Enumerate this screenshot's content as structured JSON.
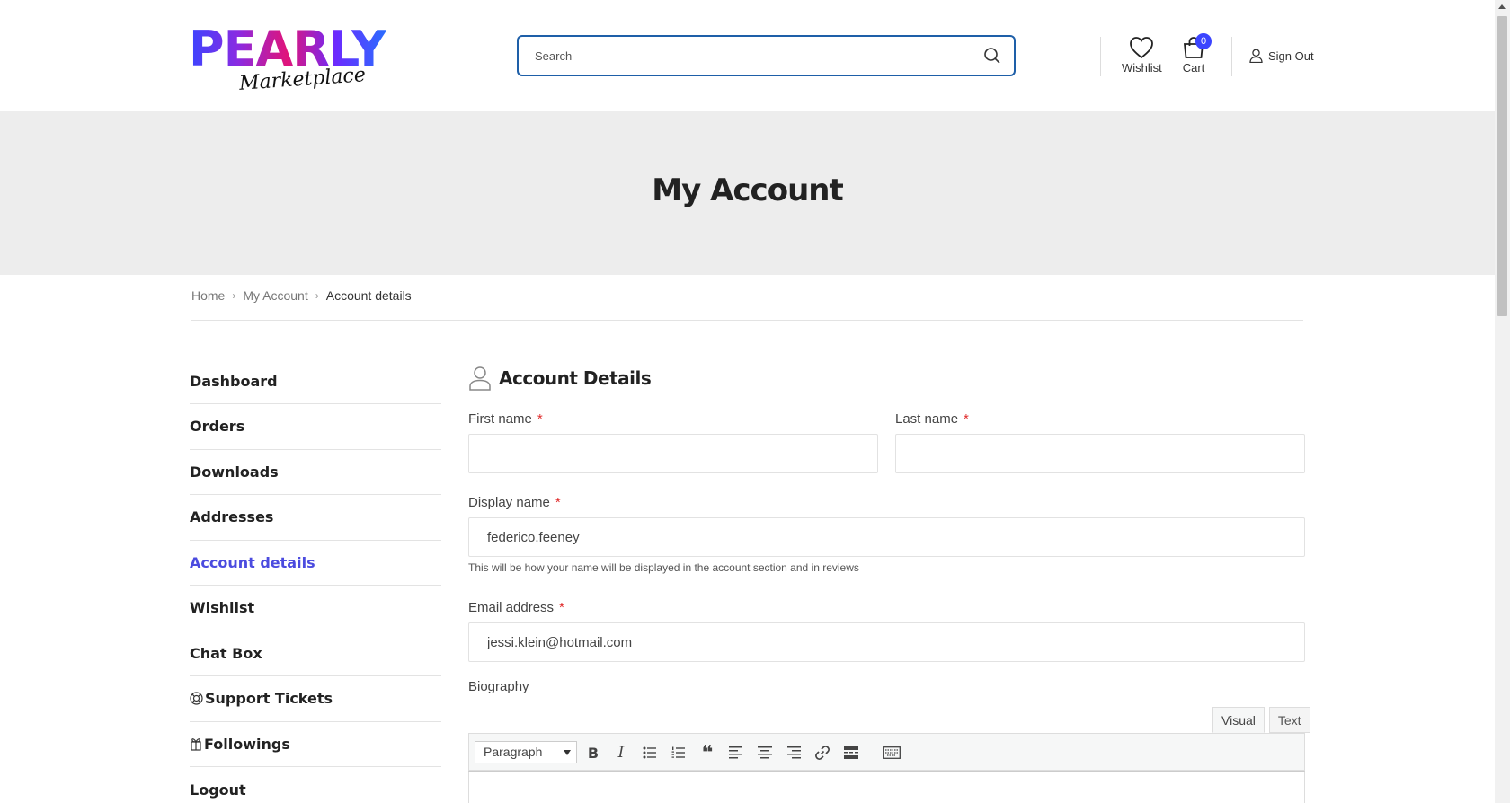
{
  "brand": {
    "name": "PEARLY",
    "tagline": "Marketplace"
  },
  "search": {
    "placeholder": "Search"
  },
  "header": {
    "wishlist_label": "Wishlist",
    "cart_label": "Cart",
    "cart_count": "0",
    "signout_label": "Sign Out"
  },
  "hero": {
    "title": "My Account"
  },
  "breadcrumb": {
    "home": "Home",
    "account": "My Account",
    "current": "Account details"
  },
  "sidebar": {
    "items": [
      {
        "label": "Dashboard"
      },
      {
        "label": "Orders"
      },
      {
        "label": "Downloads"
      },
      {
        "label": "Addresses"
      },
      {
        "label": "Account details"
      },
      {
        "label": "Wishlist"
      },
      {
        "label": "Chat Box"
      },
      {
        "label": "Support Tickets"
      },
      {
        "label": "Followings"
      },
      {
        "label": "Logout"
      }
    ]
  },
  "form": {
    "title": "Account Details",
    "first_name_label": "First name",
    "first_name_value": "",
    "last_name_label": "Last name",
    "last_name_value": "",
    "display_name_label": "Display name",
    "display_name_value": "federico.feeney",
    "display_name_hint": "This will be how your name will be displayed in the account section and in reviews",
    "email_label": "Email address",
    "email_value": "jessi.klein@hotmail.com",
    "biography_label": "Biography",
    "required_mark": "*"
  },
  "editor": {
    "tab_visual": "Visual",
    "tab_text": "Text",
    "format_value": "Paragraph",
    "bold_glyph": "B",
    "italic_glyph": "I",
    "quote_glyph": "❝"
  },
  "colors": {
    "accent": "#4b4bdf",
    "search_border": "#1e5fa8",
    "badge": "#3b44ff",
    "required": "#e02b2b"
  }
}
